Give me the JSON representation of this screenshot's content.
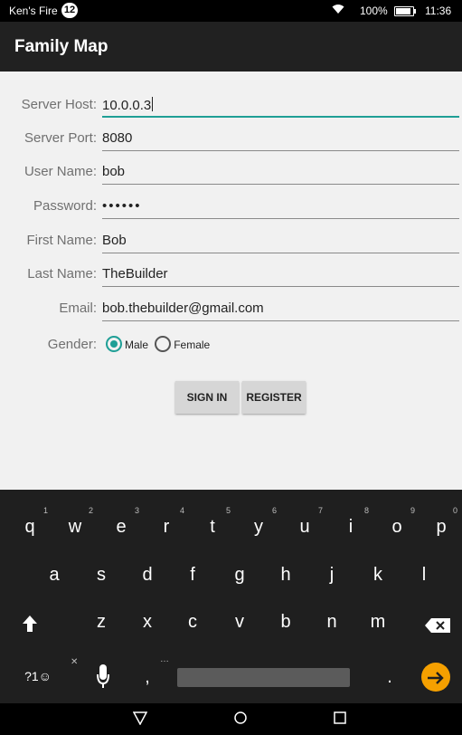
{
  "status_bar": {
    "device_name": "Ken's Fire",
    "notification_count": "12",
    "battery": "100%",
    "time": "11:36",
    "wifi_icon": "wifi-icon",
    "battery_icon": "battery-charging-icon"
  },
  "app_bar": {
    "title": "Family Map"
  },
  "form": {
    "server_host": {
      "label": "Server Host:",
      "value": "10.0.0.3"
    },
    "server_port": {
      "label": "Server Port:",
      "value": "8080"
    },
    "user_name": {
      "label": "User Name:",
      "value": "bob"
    },
    "password": {
      "label": "Password:",
      "value": "••••••"
    },
    "first_name": {
      "label": "First Name:",
      "value": "Bob"
    },
    "last_name": {
      "label": "Last Name:",
      "value": "TheBuilder"
    },
    "email": {
      "label": "Email:",
      "value": "bob.thebuilder@gmail.com"
    },
    "gender": {
      "label": "Gender:",
      "options": [
        "Male",
        "Female"
      ],
      "selected": "Male"
    },
    "sign_in_label": "SIGN IN",
    "register_label": "REGISTER"
  },
  "keyboard": {
    "row1": [
      {
        "key": "q",
        "hint": "1"
      },
      {
        "key": "w",
        "hint": "2"
      },
      {
        "key": "e",
        "hint": "3"
      },
      {
        "key": "r",
        "hint": "4"
      },
      {
        "key": "t",
        "hint": "5"
      },
      {
        "key": "y",
        "hint": "6"
      },
      {
        "key": "u",
        "hint": "7"
      },
      {
        "key": "i",
        "hint": "8"
      },
      {
        "key": "o",
        "hint": "9"
      },
      {
        "key": "p",
        "hint": "0"
      }
    ],
    "row2": [
      "a",
      "s",
      "d",
      "f",
      "g",
      "h",
      "j",
      "k",
      "l"
    ],
    "row3": [
      "z",
      "x",
      "c",
      "v",
      "b",
      "n",
      "m"
    ],
    "shift_icon": "shift-arrow-icon",
    "backspace_icon": "backspace-icon",
    "symbols_label": "?1☺",
    "comma": ",",
    "comma_hint": "…",
    "mic_hint": "✕",
    "period": ".",
    "mic_icon": "microphone-icon",
    "enter_icon": "arrow-right-icon",
    "accent_color": "#f5a000"
  },
  "nav_bar": {
    "back_icon": "triangle-back-icon",
    "home_icon": "circle-home-icon",
    "recents_icon": "square-recents-icon"
  },
  "colors": {
    "accent": "#1f9f96",
    "app_bar": "#212121",
    "background": "#f1f1f1"
  }
}
